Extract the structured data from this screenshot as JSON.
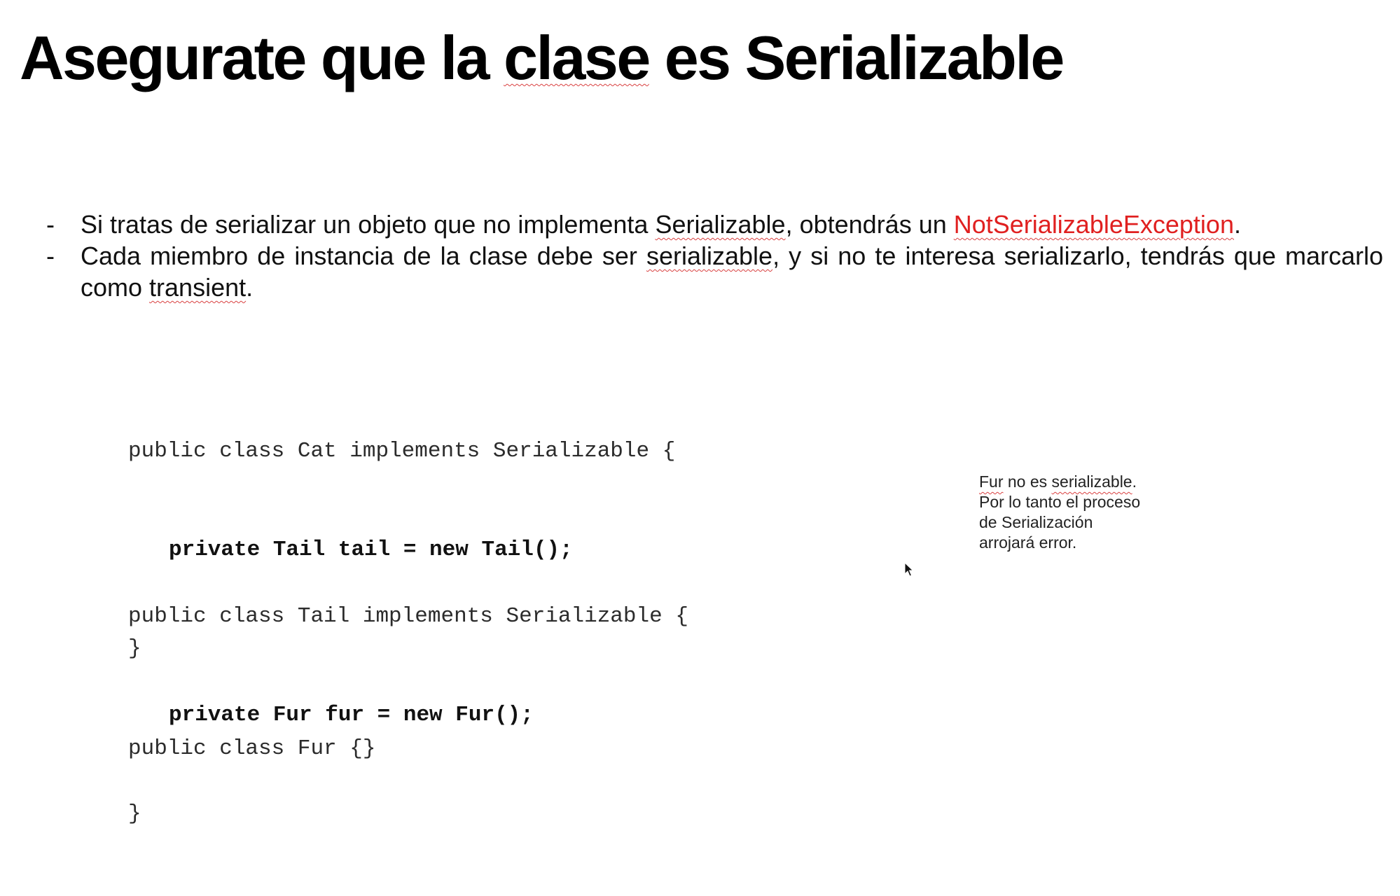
{
  "title": {
    "part1": "Asegurate que la ",
    "part2": "clase",
    "part3": " es Serializable"
  },
  "bullets": [
    {
      "marker": "-",
      "t1": "Si tratas de serializar un objeto que no implementa ",
      "t2": "Serializable",
      "t3": ", obtendrás un ",
      "t4": "NotSerializableException",
      "t5": "."
    },
    {
      "marker": "-",
      "t1": "Cada miembro de instancia de la clase debe ser ",
      "t2": "serializable",
      "t3": ", y si no te interesa serializarlo, tendrás que marcarlo como ",
      "t4": "transient",
      "t5": "."
    }
  ],
  "code": {
    "block1": [
      "public class Cat implements Serializable {",
      "private Tail tail = new Tail();",
      "}"
    ],
    "block2": [
      "public class Tail implements Serializable {",
      "private Fur fur = new Fur();",
      "}"
    ],
    "block3": [
      "public class Fur {}"
    ]
  },
  "note": {
    "line1_a": "Fur",
    "line1_b": " no es ",
    "line1_c": "serializable",
    "line1_d": ".",
    "line2": "Por lo tanto el proceso",
    "line3": "de Serialización",
    "line4": "arrojará error."
  },
  "colors": {
    "exception_text": "#e02020",
    "spellcheck_underline": "#d94040"
  },
  "icons": {
    "cursor": "mouse-pointer-icon"
  }
}
